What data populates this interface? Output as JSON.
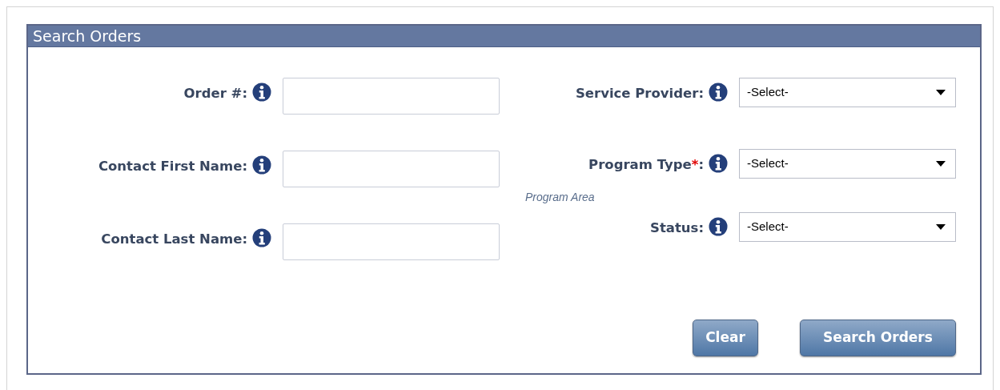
{
  "panel": {
    "title": "Search Orders"
  },
  "left_fields": [
    {
      "kind": "text",
      "label": "Order #:"
    },
    {
      "kind": "text",
      "label": "Contact First Name:"
    },
    {
      "kind": "text",
      "label": "Contact Last Name:"
    }
  ],
  "right_fields": [
    {
      "kind": "select",
      "label": "Service Provider:",
      "value": "-Select-"
    },
    {
      "kind": "select",
      "label": "Program Type",
      "required_mark": "*",
      "label_end": ":",
      "value": "-Select-",
      "hint": "Program Area"
    },
    {
      "kind": "select",
      "label": "Status:",
      "value": "-Select-"
    }
  ],
  "buttons": [
    "Clear",
    "Search Orders"
  ]
}
